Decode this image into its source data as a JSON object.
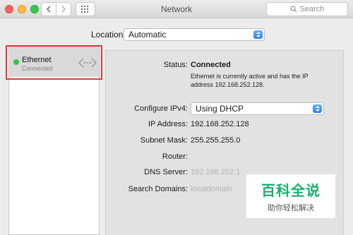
{
  "window": {
    "title": "Network"
  },
  "toolbar": {
    "search_placeholder": "Search"
  },
  "location": {
    "label": "Location:",
    "value": "Automatic"
  },
  "sidebar": {
    "items": [
      {
        "name": "Ethernet",
        "status": "Connected",
        "status_color": "#2fc646"
      }
    ]
  },
  "details": {
    "status_label": "Status:",
    "status_value": "Connected",
    "status_description": "Ethernet is currently active and has the IP address 192.168.252.128.",
    "configure_label": "Configure IPv4:",
    "configure_value": "Using DHCP",
    "ip_label": "IP Address:",
    "ip_value": "192.168.252.128",
    "subnet_label": "Subnet Mask:",
    "subnet_value": "255.255.255.0",
    "router_label": "Router:",
    "router_value": "",
    "dns_label": "DNS Server:",
    "dns_value": "192.168.252.1",
    "search_domains_label": "Search Domains:",
    "search_domains_value": "localdomain"
  },
  "watermark": {
    "title": "百科全说",
    "subtitle": "助你轻松解决"
  },
  "colors": {
    "accent": "#2d7ef3",
    "highlight_border": "#e03a3a",
    "connected": "#2fc646"
  }
}
